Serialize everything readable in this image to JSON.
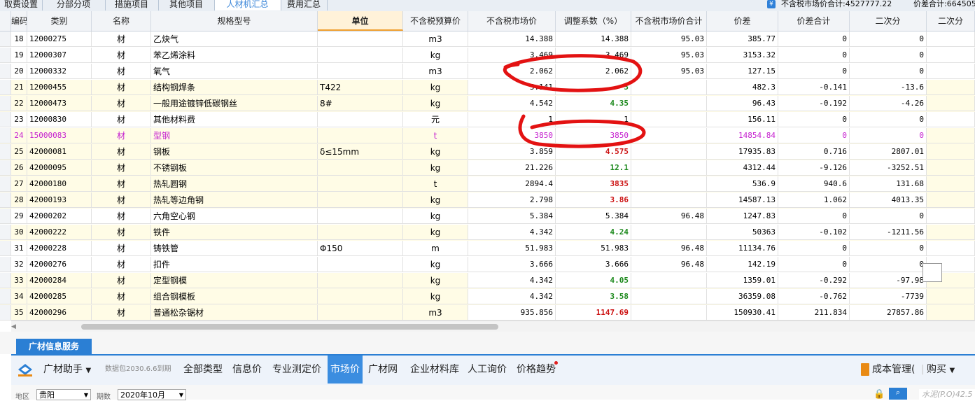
{
  "top_tabs": [
    "取费设置",
    "分部分项",
    "措施项目",
    "其他项目",
    "人材机汇总",
    "费用汇总"
  ],
  "active_tab_index": 4,
  "summary": {
    "yen_icon": "¥",
    "market_total": "不含税市场价合计:4527777.22",
    "diff_total": "价差合计:664505"
  },
  "columns": [
    "",
    "编码",
    "类别",
    "名称",
    "规格型号",
    "单位",
    "不含税预算价",
    "不含税市场价",
    "调整系数（%）",
    "不含税市场价合计",
    "价差",
    "价差合计",
    "二次分"
  ],
  "rows": [
    {
      "no": "18",
      "code": "12000275",
      "cat": "材",
      "name": "乙炔气",
      "spec": "",
      "unit": "m3",
      "budget": "14.388",
      "market": "14.388",
      "market_style": "",
      "coef": "95.03",
      "total": "385.77",
      "diff": "0",
      "diff_total": "0"
    },
    {
      "no": "19",
      "code": "12000307",
      "cat": "材",
      "name": "苯乙烯涂料",
      "spec": "",
      "unit": "kg",
      "budget": "3.469",
      "market": "3.469",
      "market_style": "",
      "coef": "95.03",
      "total": "3153.32",
      "diff": "0",
      "diff_total": "0"
    },
    {
      "no": "20",
      "code": "12000332",
      "cat": "材",
      "name": "氧气",
      "spec": "",
      "unit": "m3",
      "budget": "2.062",
      "market": "2.062",
      "market_style": "",
      "coef": "95.03",
      "total": "127.15",
      "diff": "0",
      "diff_total": "0"
    },
    {
      "no": "21",
      "code": "12000455",
      "cat": "材",
      "name": "结构钢焊条",
      "spec": "T422",
      "unit": "kg",
      "budget": "5.141",
      "market": "5",
      "market_style": "green",
      "coef": "",
      "total": "482.3",
      "diff": "-0.141",
      "diff_total": "-13.6"
    },
    {
      "no": "22",
      "code": "12000473",
      "cat": "材",
      "name": "一般用途镀锌低碳钢丝",
      "spec": "8#",
      "unit": "kg",
      "budget": "4.542",
      "market": "4.35",
      "market_style": "green",
      "coef": "",
      "total": "96.43",
      "diff": "-0.192",
      "diff_total": "-4.26"
    },
    {
      "no": "23",
      "code": "12000830",
      "cat": "材",
      "name": "其他材料费",
      "spec": "",
      "unit": "元",
      "budget": "1",
      "market": "1",
      "market_style": "",
      "coef": "",
      "total": "156.11",
      "diff": "0",
      "diff_total": "0"
    },
    {
      "no": "24",
      "code": "15000083",
      "cat": "材",
      "name": "型钢",
      "spec": "",
      "unit": "t",
      "budget": "3850",
      "market": "3850",
      "market_style": "",
      "coef": "",
      "total": "14854.84",
      "diff": "0",
      "diff_total": "0",
      "purple": true
    },
    {
      "no": "25",
      "code": "42000081",
      "cat": "材",
      "name": "钢板",
      "spec": "δ≤15mm",
      "unit": "kg",
      "budget": "3.859",
      "market": "4.575",
      "market_style": "red",
      "coef": "",
      "total": "17935.83",
      "diff": "0.716",
      "diff_total": "2807.01"
    },
    {
      "no": "26",
      "code": "42000095",
      "cat": "材",
      "name": "不锈钢板",
      "spec": "",
      "unit": "kg",
      "budget": "21.226",
      "market": "12.1",
      "market_style": "green",
      "coef": "",
      "total": "4312.44",
      "diff": "-9.126",
      "diff_total": "-3252.51"
    },
    {
      "no": "27",
      "code": "42000180",
      "cat": "材",
      "name": "热轧圆钢",
      "spec": "",
      "unit": "t",
      "budget": "2894.4",
      "market": "3835",
      "market_style": "red",
      "coef": "",
      "total": "536.9",
      "diff": "940.6",
      "diff_total": "131.68"
    },
    {
      "no": "28",
      "code": "42000193",
      "cat": "材",
      "name": "热轧等边角钢",
      "spec": "",
      "unit": "kg",
      "budget": "2.798",
      "market": "3.86",
      "market_style": "red",
      "coef": "",
      "total": "14587.13",
      "diff": "1.062",
      "diff_total": "4013.35"
    },
    {
      "no": "29",
      "code": "42000202",
      "cat": "材",
      "name": "六角空心钢",
      "spec": "",
      "unit": "kg",
      "budget": "5.384",
      "market": "5.384",
      "market_style": "",
      "coef": "96.48",
      "total": "1247.83",
      "diff": "0",
      "diff_total": "0"
    },
    {
      "no": "30",
      "code": "42000222",
      "cat": "材",
      "name": "铁件",
      "spec": "",
      "unit": "kg",
      "budget": "4.342",
      "market": "4.24",
      "market_style": "green",
      "coef": "",
      "total": "50363",
      "diff": "-0.102",
      "diff_total": "-1211.56"
    },
    {
      "no": "31",
      "code": "42000228",
      "cat": "材",
      "name": "铸铁管",
      "spec": "Φ150",
      "unit": "m",
      "budget": "51.983",
      "market": "51.983",
      "market_style": "",
      "coef": "96.48",
      "total": "11134.76",
      "diff": "0",
      "diff_total": "0"
    },
    {
      "no": "32",
      "code": "42000276",
      "cat": "材",
      "name": "扣件",
      "spec": "",
      "unit": "kg",
      "budget": "3.666",
      "market": "3.666",
      "market_style": "",
      "coef": "96.48",
      "total": "142.19",
      "diff": "0",
      "diff_total": "0"
    },
    {
      "no": "33",
      "code": "42000284",
      "cat": "材",
      "name": "定型钢模",
      "spec": "",
      "unit": "kg",
      "budget": "4.342",
      "market": "4.05",
      "market_style": "green",
      "coef": "",
      "total": "1359.01",
      "diff": "-0.292",
      "diff_total": "-97.98"
    },
    {
      "no": "34",
      "code": "42000285",
      "cat": "材",
      "name": "组合钢模板",
      "spec": "",
      "unit": "kg",
      "budget": "4.342",
      "market": "3.58",
      "market_style": "green",
      "coef": "",
      "total": "36359.08",
      "diff": "-0.762",
      "diff_total": "-7739"
    },
    {
      "no": "35",
      "code": "42000296",
      "cat": "材",
      "name": "普通松杂锯材",
      "spec": "",
      "unit": "m3",
      "budget": "935.856",
      "market": "1147.69",
      "market_style": "red",
      "coef": "",
      "total": "150930.41",
      "diff": "211.834",
      "diff_total": "27857.86"
    }
  ],
  "service": {
    "tab_label": "广材信息服务",
    "assistant": "广材助手",
    "data_pack": "数据包2030.6.6到期",
    "menu": [
      "全部类型",
      "信息价",
      "专业测定价",
      "市场价",
      "广材网",
      "企业材料库",
      "人工询价",
      "价格趋势"
    ],
    "active_menu_index": 3,
    "right_items": [
      "成本管理(",
      "购买"
    ],
    "region_label": "地区",
    "region_value": "贵阳",
    "period_label": "期数",
    "period_value": "2020年10月",
    "search_placeholder": "水泥(P.O)42.5"
  },
  "colors": {
    "accent": "#2b7fd4",
    "annotation": "#e31212",
    "purple_row": "#c51fcf",
    "green_value": "#1e8a1e",
    "red_value": "#cc1111"
  }
}
